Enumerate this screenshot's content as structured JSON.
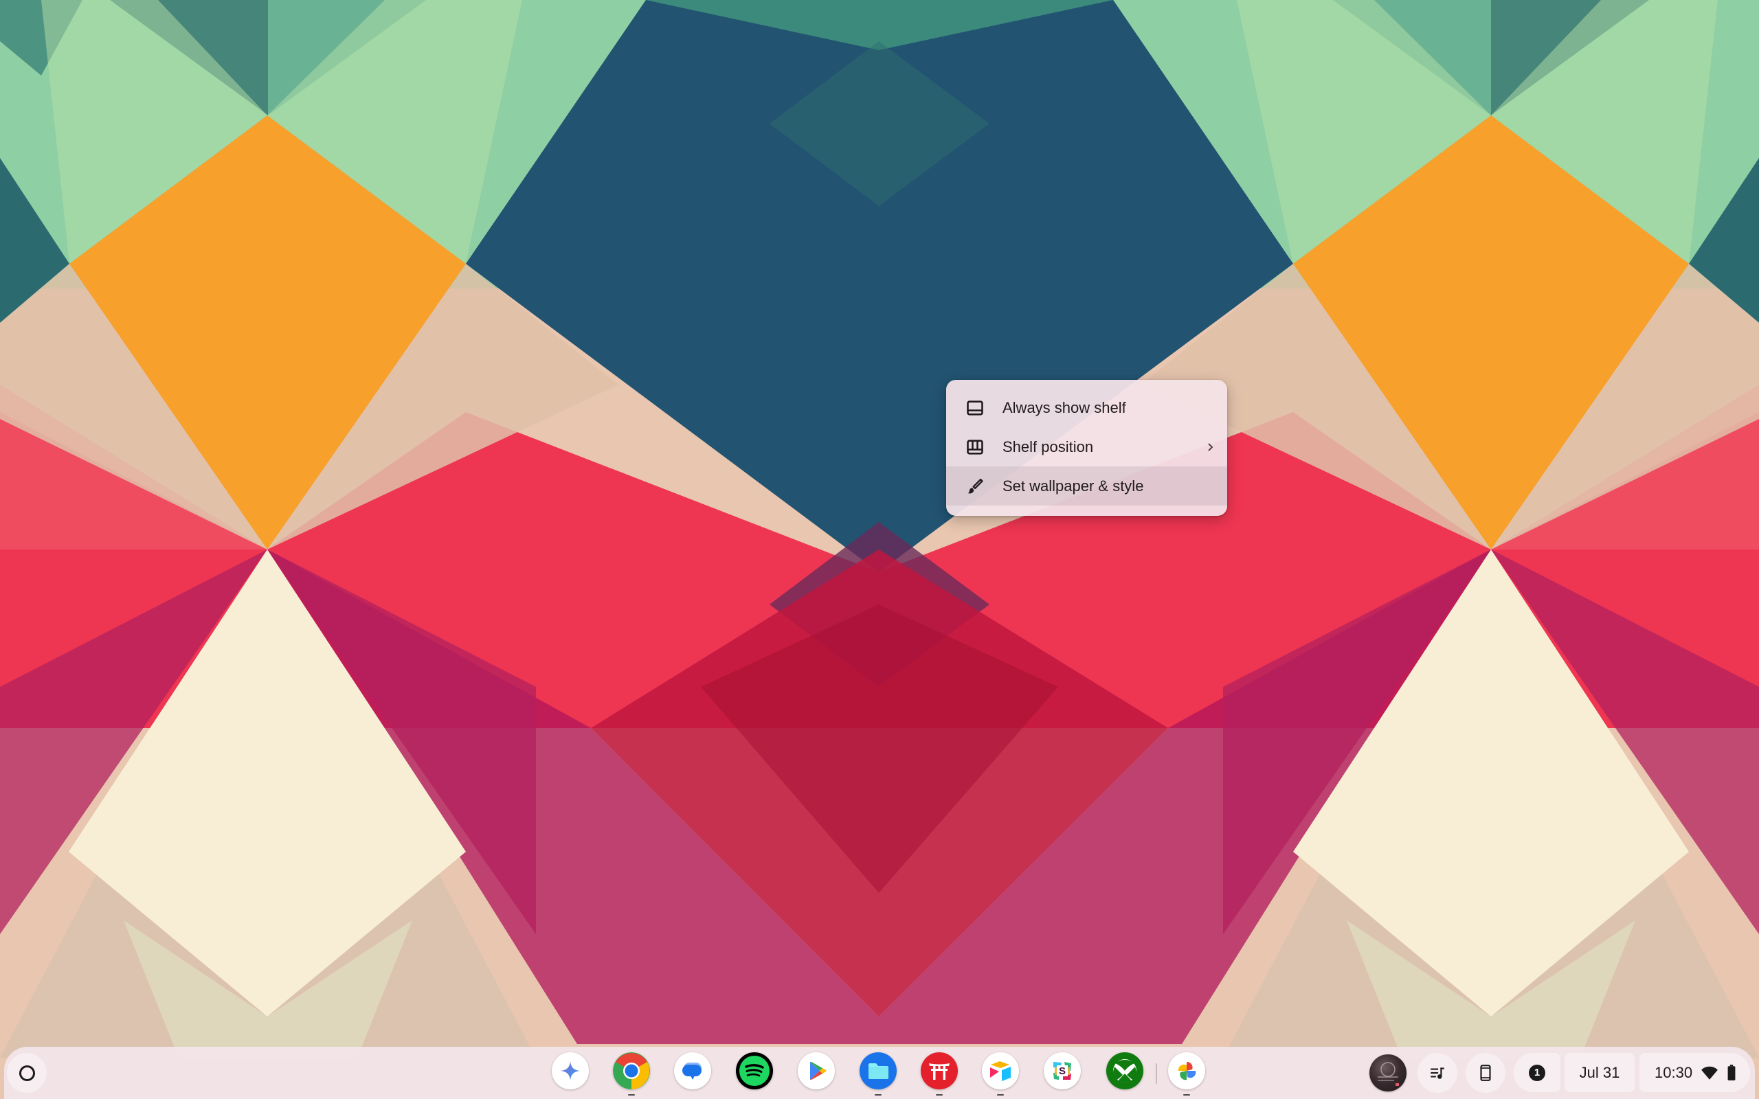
{
  "desktop": {
    "wallpaper": "geometric-kaleidoscope",
    "colors": {
      "orange": "#f7a02c",
      "teal": "#2e6b73",
      "navy": "#1f4a72",
      "mint": "#86cc9e",
      "red": "#ee3552",
      "crimson": "#c0163f",
      "magenta": "#a8145a",
      "cream": "#f6ecd0",
      "sand": "#d8c2ae"
    }
  },
  "context_menu": {
    "items": [
      {
        "label": "Always show shelf",
        "icon": "shelf-bottom-icon",
        "has_submenu": false
      },
      {
        "label": "Shelf position",
        "icon": "shelf-position-icon",
        "has_submenu": true
      },
      {
        "label": "Set wallpaper & style",
        "icon": "paintbrush-icon",
        "has_submenu": false,
        "hovered": true
      }
    ]
  },
  "shelf": {
    "launcher": {
      "icon": "launcher-circle-icon"
    },
    "pinned_apps": [
      {
        "name": "Gemini",
        "icon": "gemini-icon",
        "running": false
      },
      {
        "name": "Chrome",
        "icon": "chrome-icon",
        "running": true
      },
      {
        "name": "Messages",
        "icon": "messages-icon",
        "running": false
      },
      {
        "name": "Spotify",
        "icon": "spotify-icon",
        "running": false
      },
      {
        "name": "Play Store",
        "icon": "play-store-icon",
        "running": false
      },
      {
        "name": "Files",
        "icon": "files-icon",
        "running": true
      },
      {
        "name": "Torii",
        "icon": "torii-icon",
        "running": true
      },
      {
        "name": "Airtable",
        "icon": "airtable-icon",
        "running": true
      },
      {
        "name": "Slack",
        "icon": "slack-icon",
        "running": false
      },
      {
        "name": "Xbox",
        "icon": "xbox-icon",
        "running": false
      }
    ],
    "other_apps": [
      {
        "name": "Photos",
        "icon": "photos-icon",
        "running": true
      }
    ]
  },
  "status_area": {
    "holding_space": {
      "icon": "holding-space-thumbnail"
    },
    "media_controls": {
      "icon": "media-queue-icon"
    },
    "phone_hub": {
      "icon": "phone-icon"
    },
    "notifications": {
      "count": "1"
    },
    "date": "Jul 31",
    "time": "10:30",
    "wifi": {
      "icon": "wifi-icon",
      "status": "connected"
    },
    "battery": {
      "icon": "battery-icon",
      "level": "full"
    }
  }
}
